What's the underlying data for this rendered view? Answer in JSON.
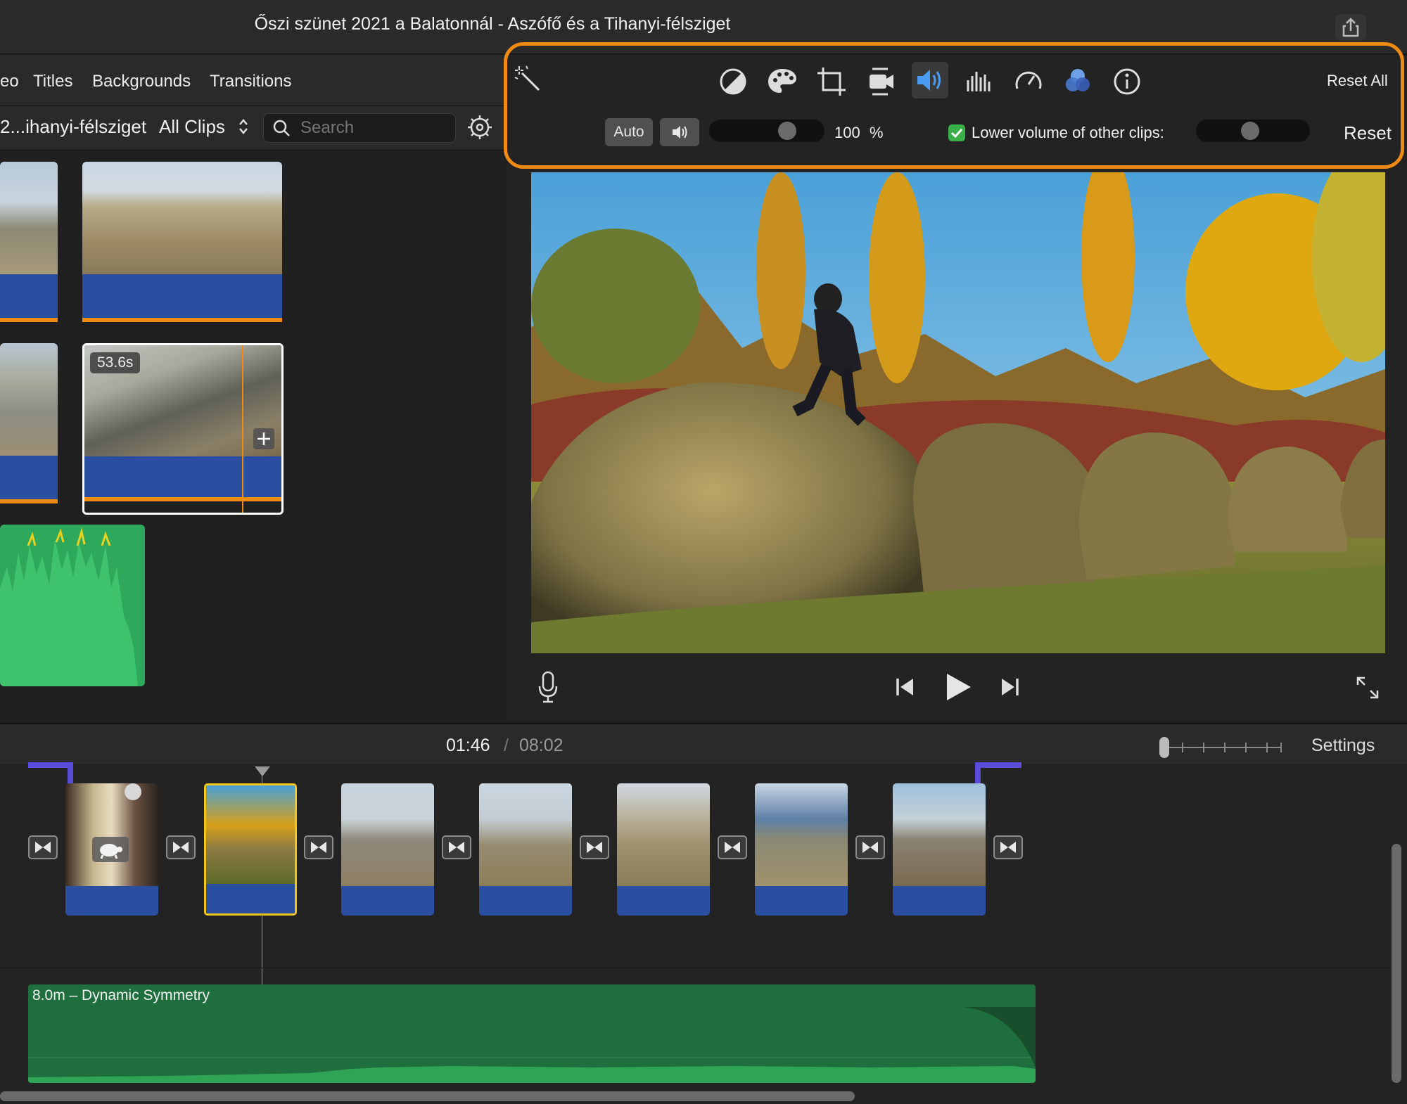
{
  "window": {
    "title": "Őszi szünet 2021 a Balatonnál - Aszófő és a Tihanyi-félsziget"
  },
  "browser_tabs": [
    "eo",
    "Titles",
    "Backgrounds",
    "Transitions"
  ],
  "library": {
    "event_name": "2...ihanyi-félsziget",
    "filter": "All Clips",
    "search_placeholder": "Search",
    "clip_duration": "53.6s"
  },
  "inspector": {
    "reset_all": "Reset All",
    "auto_label": "Auto",
    "volume_value": "100",
    "volume_unit": "%",
    "volume_level": 0.72,
    "lower_volume_label": "Lower volume of other clips:",
    "lower_volume_checked": true,
    "reset_label": "Reset",
    "tools": [
      "magic-wand-icon",
      "color-balance-icon",
      "color-palette-icon",
      "crop-icon",
      "stabilization-icon",
      "volume-icon",
      "equalizer-icon",
      "speed-icon",
      "filter-icon",
      "info-icon"
    ]
  },
  "timeline": {
    "current_time": "01:46",
    "separator": "/",
    "total_time": "08:02",
    "settings_label": "Settings",
    "music_track": "8.0m – Dynamic Symmetry"
  },
  "colors": {
    "accent_orange": "#ef8a12",
    "selection_yellow": "#f2c418",
    "audio_blue": "#2a4fa0",
    "music_green": "#1f6e3e",
    "volume_active": "#4a9cf2"
  }
}
